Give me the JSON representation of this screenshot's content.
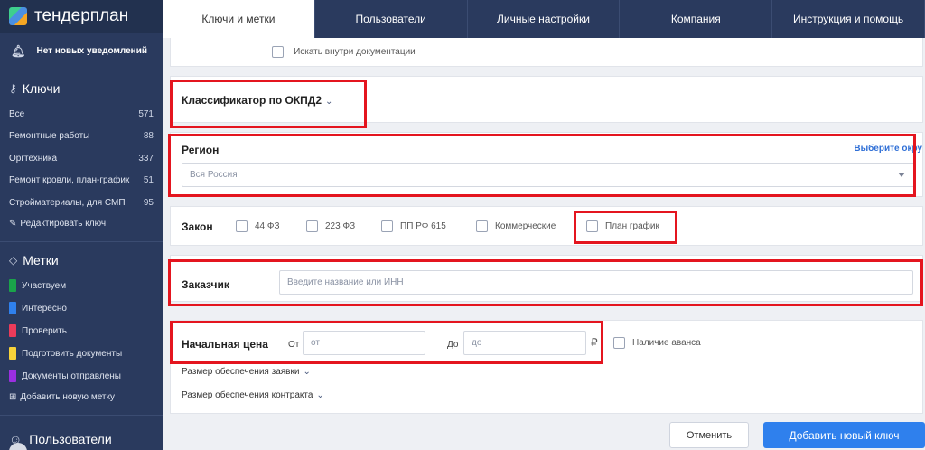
{
  "logo": {
    "text": "тендерплан"
  },
  "notifications": {
    "text": "Нет новых уведомлений",
    "icon": "bell-icon"
  },
  "keys": {
    "heading": "Ключи",
    "items": [
      {
        "label": "Все",
        "count": "571"
      },
      {
        "label": "Ремонтные работы",
        "count": "88"
      },
      {
        "label": "Оргтехника",
        "count": "337"
      },
      {
        "label": "Ремонт кровли, план-график",
        "count": "51"
      },
      {
        "label": "Стройматериалы, для СМП",
        "count": "95"
      }
    ],
    "edit_label": "Редактировать ключ"
  },
  "tags": {
    "heading": "Метки",
    "items": [
      {
        "label": "Участвуем",
        "color": "#1aa34a"
      },
      {
        "label": "Интересно",
        "color": "#2f80ed"
      },
      {
        "label": "Проверить",
        "color": "#eb3b5a"
      },
      {
        "label": "Подготовить документы",
        "color": "#f7d23a"
      },
      {
        "label": "Документы отправлены",
        "color": "#9b2fe0"
      }
    ],
    "add_label": "Добавить новую метку"
  },
  "users": {
    "heading": "Пользователи"
  },
  "tabs": [
    {
      "label": "Ключи и метки"
    },
    {
      "label": "Пользователи"
    },
    {
      "label": "Личные настройки"
    },
    {
      "label": "Компания"
    },
    {
      "label": "Инструкция и помощь"
    }
  ],
  "form": {
    "search_docs_label": "Искать внутри документации",
    "okpd": {
      "title": "Классификатор по ОКПД2"
    },
    "region": {
      "title": "Регион",
      "link": "Выберите окру",
      "value": "Вся Россия"
    },
    "law": {
      "title": "Закон",
      "options": [
        "44 ФЗ",
        "223 ФЗ",
        "ПП РФ 615",
        "Коммерческие",
        "План график"
      ]
    },
    "customer": {
      "title": "Заказчик",
      "placeholder": "Введите название или ИНН"
    },
    "price": {
      "title": "Начальная цена",
      "from_label": "От",
      "from_placeholder": "от",
      "to_label": "До",
      "to_placeholder": "до",
      "currency": "₽",
      "advance_label": "Наличие аванса",
      "bid_security": "Размер обеспечения заявки",
      "contract_security": "Размер обеспечения контракта"
    }
  },
  "buttons": {
    "cancel": "Отменить",
    "add": "Добавить новый ключ"
  }
}
